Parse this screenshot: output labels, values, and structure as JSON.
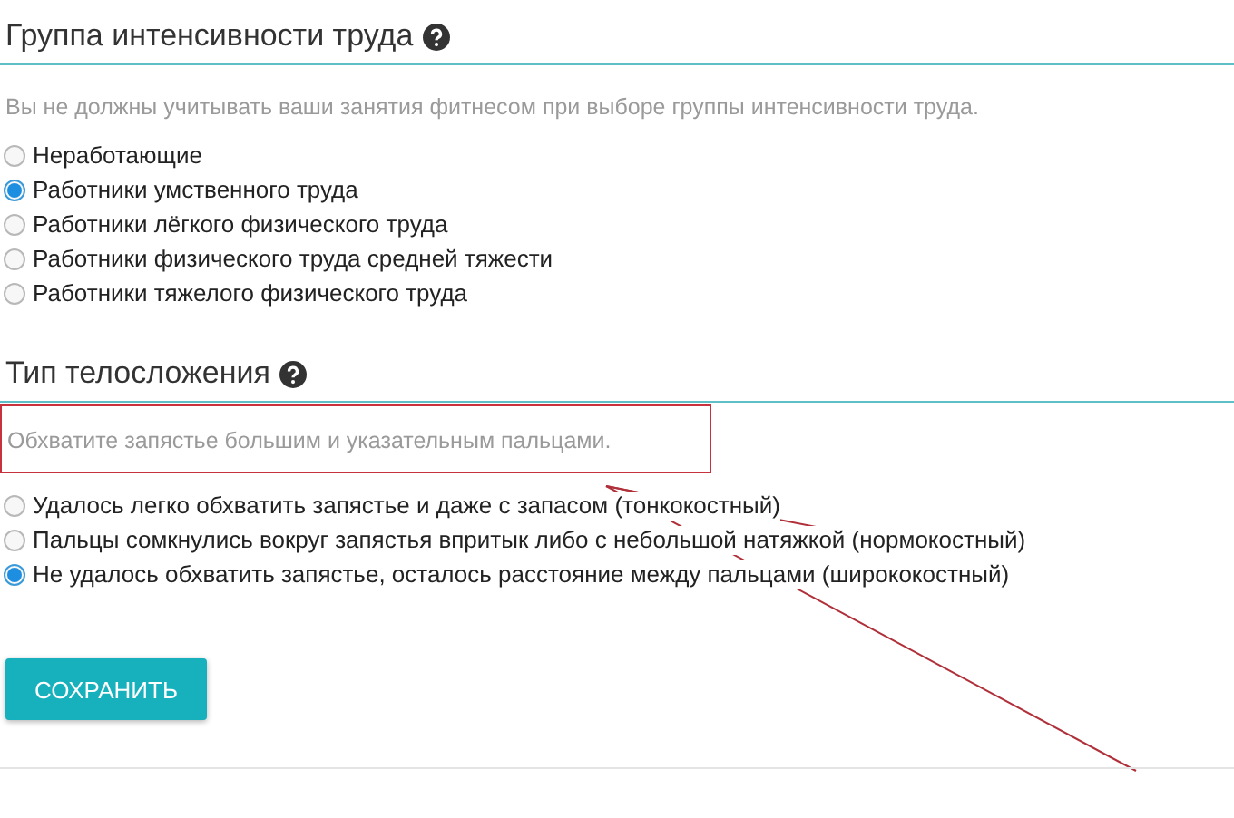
{
  "sections": [
    {
      "title": "Группа интенсивности труда",
      "hint": "Вы не должны учитывать ваши занятия фитнесом при выборе группы интенсивности труда.",
      "hint_highlighted": false,
      "options": [
        {
          "label": "Неработающие",
          "selected": false
        },
        {
          "label": "Работники умственного труда",
          "selected": true
        },
        {
          "label": "Работники лёгкого физического труда",
          "selected": false
        },
        {
          "label": "Работники физического труда средней тяжести",
          "selected": false
        },
        {
          "label": "Работники тяжелого физического труда",
          "selected": false
        }
      ]
    },
    {
      "title": "Тип телосложения",
      "hint": "Обхватите запястье большим и указательным пальцами.",
      "hint_highlighted": true,
      "options": [
        {
          "label": "Удалось легко обхватить запястье и даже с запасом (тонкокостный)",
          "selected": false
        },
        {
          "label": "Пальцы сомкнулись вокруг запястья впритык либо с небольшой натяжкой (нормокостный)",
          "selected": false
        },
        {
          "label": "Не удалось обхватить запястье, осталось расстояние между пальцами (ширококостный)",
          "selected": true
        }
      ]
    }
  ],
  "save_button": "СОХРАНИТЬ"
}
